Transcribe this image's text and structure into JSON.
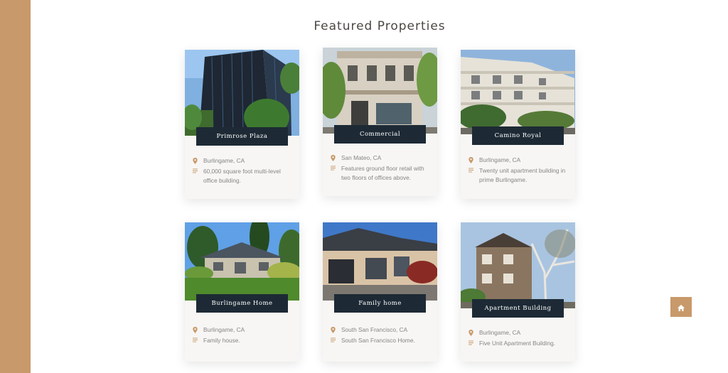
{
  "section": {
    "title": "Featured Properties"
  },
  "cards": [
    {
      "title": "Primrose Plaza",
      "location": "Burlingame, CA",
      "description": "60,000 square foot multi-level office building."
    },
    {
      "title": "Commercial",
      "location": "San Mateo, CA",
      "description": "Features ground floor retail with two floors of offices above."
    },
    {
      "title": "Camino Royal",
      "location": "Burlingame, CA",
      "description": "Twenty unit apartment building in prime Burlingame."
    },
    {
      "title": "Burlingame Home",
      "location": "Burlingame, CA",
      "description": "Family house."
    },
    {
      "title": "Family home",
      "location": "South San Francisco, CA",
      "description": "South San Francisco Home."
    },
    {
      "title": "Apartment Building",
      "location": "Burlingame, CA",
      "description": "Five Unit Apartment Building."
    }
  ],
  "icons": {
    "location": "map-pin-icon",
    "description": "text-lines-icon",
    "scroll_top": "home-icon"
  },
  "colors": {
    "accent": "#c8996a",
    "label_bg": "#1d2a35",
    "card_bg": "#f7f6f4",
    "text_muted": "#858585"
  }
}
